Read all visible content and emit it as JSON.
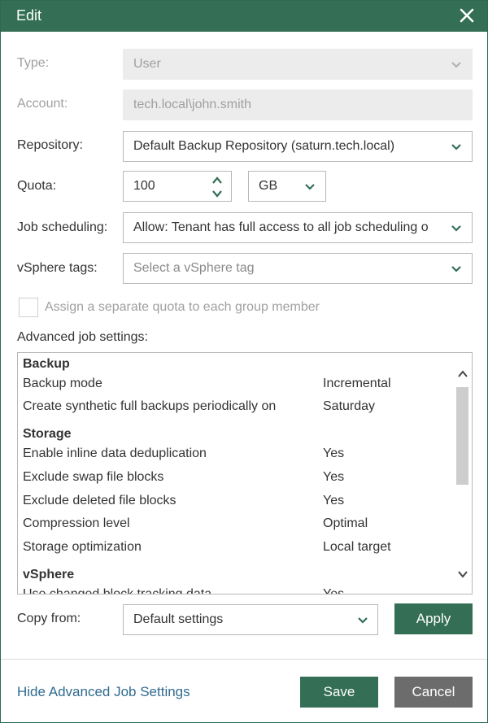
{
  "dialog": {
    "title": "Edit"
  },
  "form": {
    "type": {
      "label": "Type:",
      "value": "User"
    },
    "account": {
      "label": "Account:",
      "value": "tech.local\\john.smith"
    },
    "repository": {
      "label": "Repository:",
      "value": "Default Backup Repository (saturn.tech.local)"
    },
    "quota": {
      "label": "Quota:",
      "value": "100",
      "unit": "GB"
    },
    "job_scheduling": {
      "label": "Job scheduling:",
      "value": "Allow: Tenant has full access to all job scheduling o"
    },
    "vsphere_tags": {
      "label": "vSphere tags:",
      "placeholder": "Select a vSphere tag"
    },
    "group_quota": {
      "label": "Assign a separate quota to each group member",
      "checked": false
    }
  },
  "advanced": {
    "label": "Advanced job settings:",
    "groups": [
      {
        "name": "Backup",
        "rows": [
          {
            "key": "Backup mode",
            "value": "Incremental"
          },
          {
            "key": "Create synthetic full backups periodically on",
            "value": "Saturday"
          }
        ]
      },
      {
        "name": "Storage",
        "rows": [
          {
            "key": "Enable inline data deduplication",
            "value": "Yes"
          },
          {
            "key": "Exclude swap file blocks",
            "value": "Yes"
          },
          {
            "key": "Exclude deleted file blocks",
            "value": "Yes"
          },
          {
            "key": "Compression level",
            "value": "Optimal"
          },
          {
            "key": "Storage optimization",
            "value": "Local target"
          }
        ]
      },
      {
        "name": "vSphere",
        "rows": [
          {
            "key": "Use changed block tracking data",
            "value": "Yes"
          }
        ]
      }
    ]
  },
  "copy_from": {
    "label": "Copy from:",
    "value": "Default settings",
    "apply_label": "Apply"
  },
  "footer": {
    "link": "Hide Advanced Job Settings",
    "save_label": "Save",
    "cancel_label": "Cancel"
  },
  "colors": {
    "accent": "#336e55",
    "link": "#2f6b8f",
    "cancel": "#6c6c6c"
  },
  "icons": [
    "close-icon",
    "chevron-down-icon",
    "chevron-up-icon",
    "checkbox-icon"
  ]
}
